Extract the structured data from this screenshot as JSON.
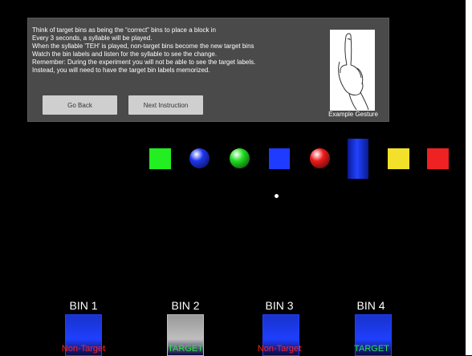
{
  "instructions": {
    "lines": [
      "Think of target bins as being the “correct” bins to place a block in",
      "Every 3 seconds, a syllable will be played.",
      "When the syllable 'TEH' is played, non-target bins become the new target bins",
      "Watch the bin labels and listen for the syllable to see the change.",
      "Remember: During the experiment you will not be able to see the target labels.",
      "Instead, you will need to have the target bin labels memorized."
    ],
    "buttons": {
      "back": "Go Back",
      "next": "Next Instruction"
    },
    "gesture_caption": "Example Gesture"
  },
  "objects": [
    {
      "shape": "cube",
      "color": "#22ee22"
    },
    {
      "shape": "sphere",
      "color": "#1e35ee"
    },
    {
      "shape": "sphere",
      "color": "#22dd22"
    },
    {
      "shape": "cube",
      "color": "#1f3bff"
    },
    {
      "shape": "sphere",
      "color": "#ee1b1b"
    },
    {
      "shape": "cylinder",
      "color": "#2242ff"
    },
    {
      "shape": "cube",
      "color": "#f2e02a"
    },
    {
      "shape": "cube",
      "color": "#ee2222"
    }
  ],
  "bins": [
    {
      "label": "BIN 1",
      "status": "Non-Target",
      "status_color": "#ff2222",
      "box_color": "#1f3fff"
    },
    {
      "label": "BIN 2",
      "status": "TARGET",
      "status_color": "#2ee04a",
      "box_color": "#bfbfbf"
    },
    {
      "label": "BIN 3",
      "status": "Non-Target",
      "status_color": "#ff2222",
      "box_color": "#1f3fff"
    },
    {
      "label": "BIN 4",
      "status": "TARGET",
      "status_color": "#2ee04a",
      "box_color": "#1f3fff"
    }
  ]
}
